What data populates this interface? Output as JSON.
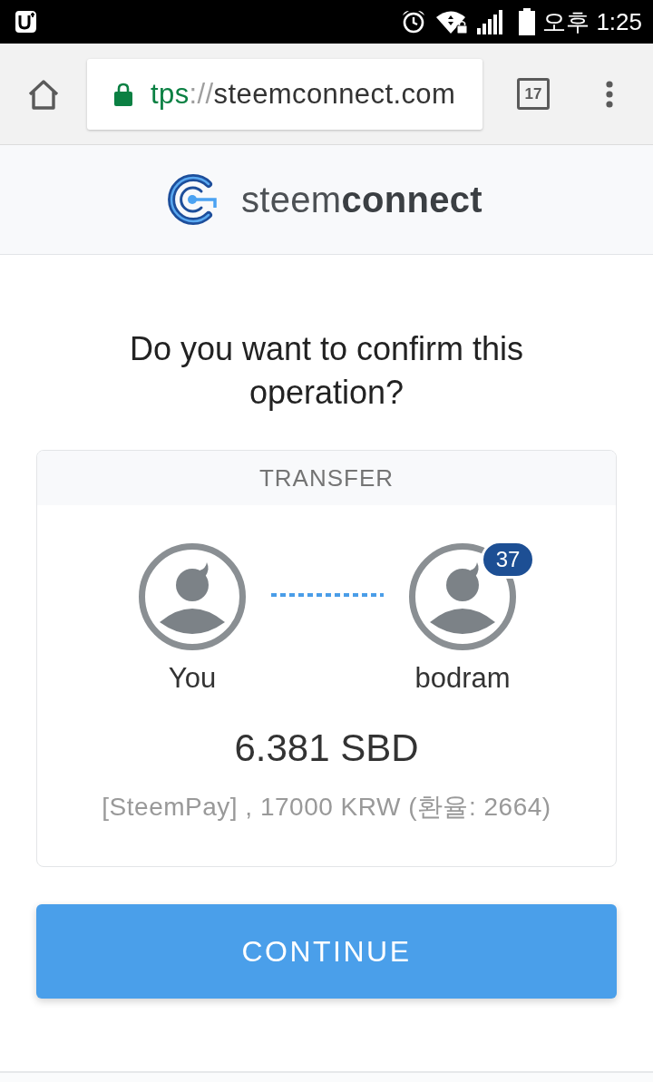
{
  "status_bar": {
    "time": "오후 1:25"
  },
  "browser": {
    "url": {
      "scheme": "tps",
      "separator": "://",
      "host": "steemconnect.com"
    },
    "tab_count": "17"
  },
  "header": {
    "logo_text": "steem**connect**"
  },
  "question": "Do you want to confirm this operation?",
  "operation": {
    "title": "TRANSFER",
    "participants": [
      {
        "name": "You"
      },
      {
        "name": "bodram",
        "badge": "37"
      }
    ],
    "amount": "6.381 SBD",
    "memo": "[SteemPay] , 17000 KRW (환율: 2664)"
  },
  "button": {
    "label": "CONTINUE"
  }
}
